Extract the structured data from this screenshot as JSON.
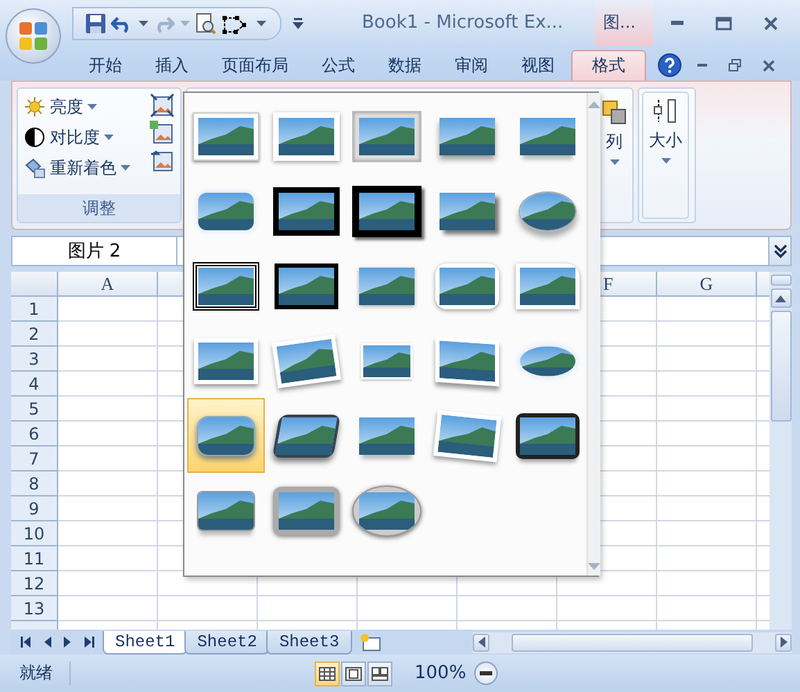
{
  "window": {
    "title": "Book1  -  Microsoft Ex...",
    "context_tab": "图..."
  },
  "ribbon_tabs": [
    {
      "label": "开始",
      "selected": false
    },
    {
      "label": "插入",
      "selected": false
    },
    {
      "label": "页面布局",
      "selected": false
    },
    {
      "label": "公式",
      "selected": false
    },
    {
      "label": "数据",
      "selected": false
    },
    {
      "label": "审阅",
      "selected": false
    },
    {
      "label": "视图",
      "selected": false
    },
    {
      "label": "格式",
      "selected": true
    }
  ],
  "adjust_group": {
    "title": "调整",
    "commands": [
      "亮度",
      "对比度",
      "重新着色"
    ]
  },
  "arrange_group": {
    "label": "列"
  },
  "size_group": {
    "label": "大小"
  },
  "name_box": {
    "value": "图片 2"
  },
  "column_headers": [
    "A",
    "F",
    "G"
  ],
  "row_headers": [
    "1",
    "2",
    "3",
    "4",
    "5",
    "6",
    "7",
    "8",
    "9",
    "10",
    "11",
    "12",
    "13"
  ],
  "picture_styles": [
    {
      "selected": false
    },
    {
      "selected": false
    },
    {
      "selected": false
    },
    {
      "selected": false
    },
    {
      "selected": false
    },
    {
      "selected": false
    },
    {
      "selected": false
    },
    {
      "selected": false
    },
    {
      "selected": false
    },
    {
      "selected": false
    },
    {
      "selected": false
    },
    {
      "selected": false
    },
    {
      "selected": false
    },
    {
      "selected": false
    },
    {
      "selected": false
    },
    {
      "selected": false
    },
    {
      "selected": false
    },
    {
      "selected": false
    },
    {
      "selected": false
    },
    {
      "selected": false
    },
    {
      "selected": true
    },
    {
      "selected": false
    },
    {
      "selected": false
    },
    {
      "selected": false
    },
    {
      "selected": false
    },
    {
      "selected": false
    },
    {
      "selected": false
    },
    {
      "selected": false
    }
  ],
  "sheet_tabs": [
    {
      "label": "Sheet1",
      "selected": true
    },
    {
      "label": "Sheet2",
      "selected": false
    },
    {
      "label": "Sheet3",
      "selected": false
    }
  ],
  "status_bar": {
    "text": "就绪",
    "views": [
      {
        "selected": true
      },
      {
        "selected": false
      },
      {
        "selected": false
      }
    ],
    "zoom": "100%"
  }
}
